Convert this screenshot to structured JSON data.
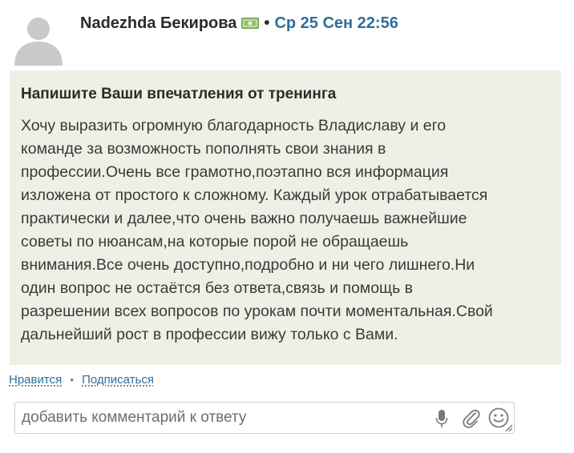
{
  "post": {
    "author_name": "Nadezhda Бекирова",
    "badge_icon": "money-icon",
    "separator": "•",
    "date": "Ср 25 Сен 22:56",
    "title": "Напишите Ваши впечатления от тренинга",
    "body_lines": [
      "Хочу выразить огромную благодарность Владиславу и его",
      "команде за возможность пополнять свои знания в",
      "профессии.Очень все грамотно,поэтапно вся информация",
      "изложена от простого к сложному. Каждый урок отрабатывается",
      "практически и далее,что очень важно получаешь важнейшие",
      "советы по нюансам,на которые порой не обращаешь",
      "внимания.Все очень доступно,подробно и ни чего лишнего.Ни",
      "один вопрос не остаётся без ответа,связь и помощь в",
      "разрешении всех вопросов по урокам почти моментальная.Свой",
      "дальнейший рост в профессии вижу только с Вами."
    ]
  },
  "actions": {
    "like_label": "Нравится",
    "separator": "•",
    "subscribe_label": "Подписаться"
  },
  "comment": {
    "placeholder": "добавить комментарий к ответу",
    "value": "",
    "icons": [
      "microphone-icon",
      "paperclip-icon",
      "smiley-icon",
      "resize-handle-icon"
    ]
  },
  "colors": {
    "link": "#2f6e98",
    "card_background": "#efefe6",
    "money_badge": "#8fbf6a"
  }
}
